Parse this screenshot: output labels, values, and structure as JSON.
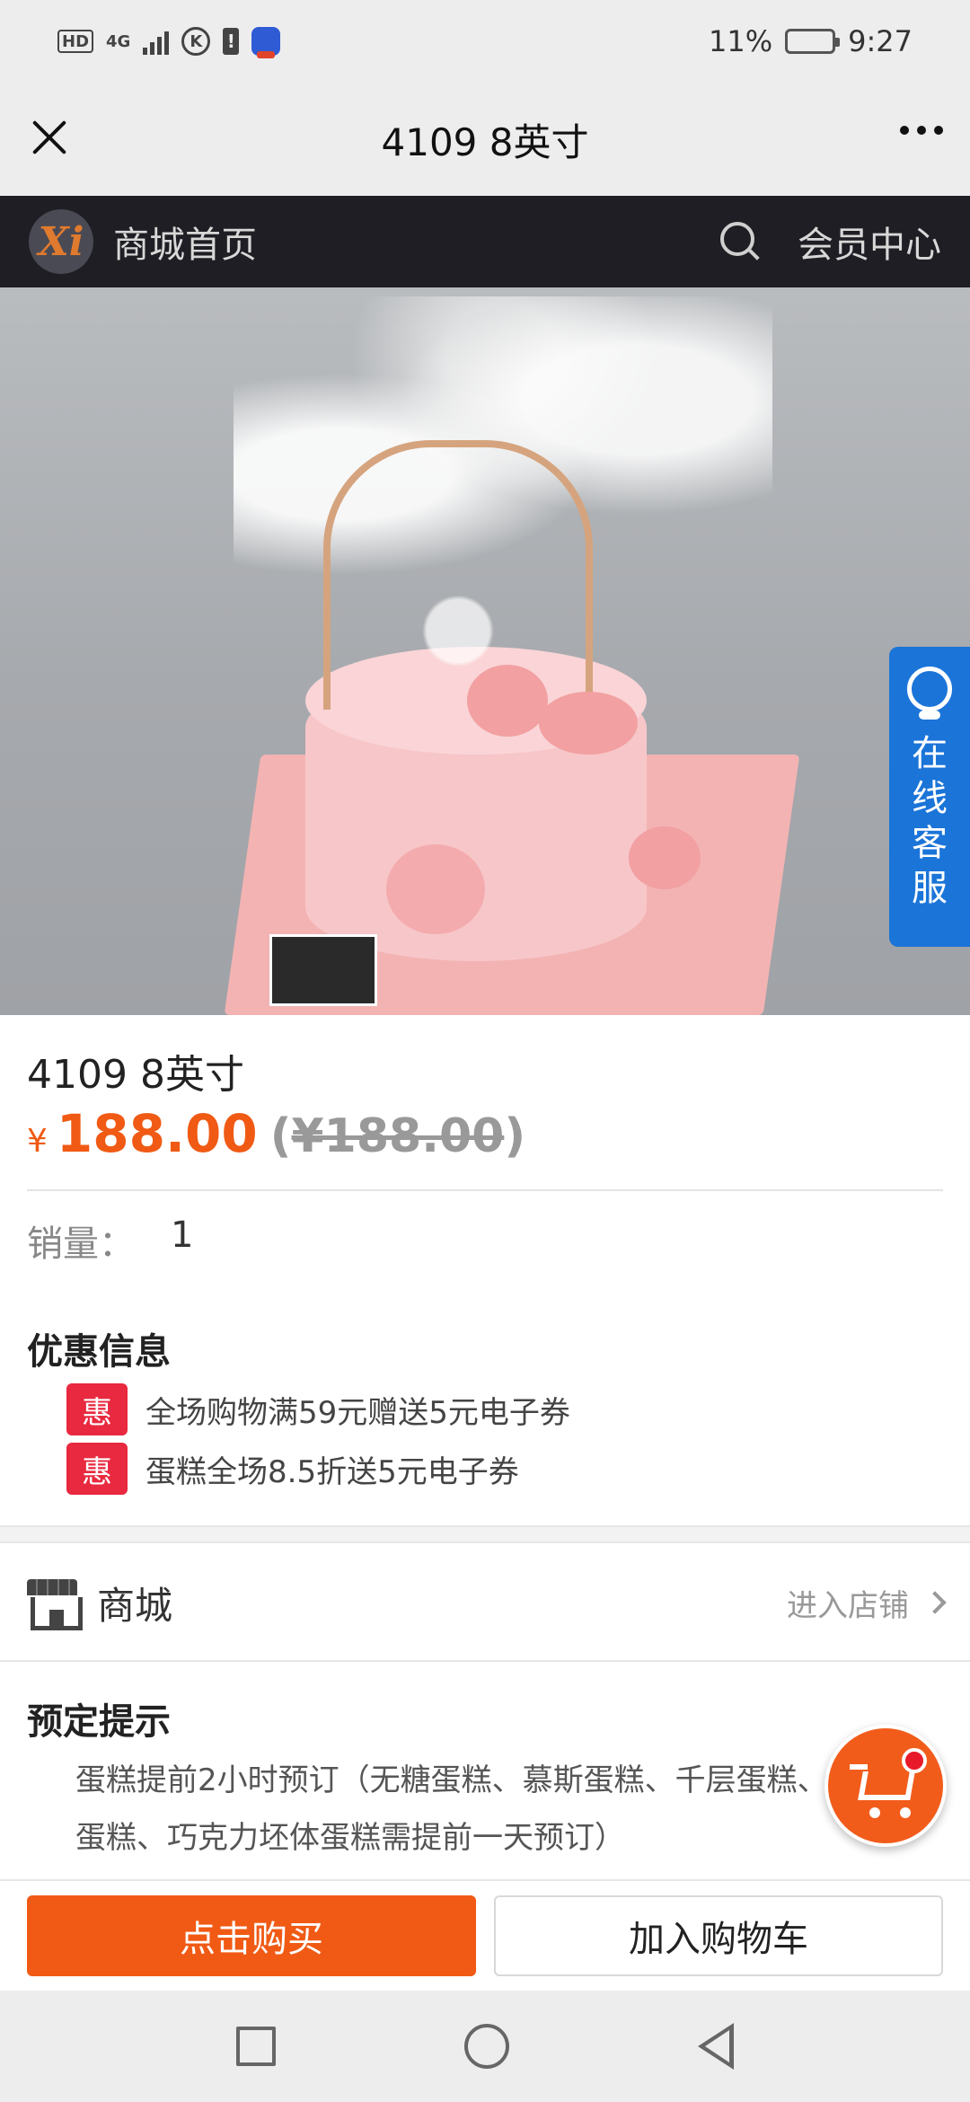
{
  "status_bar": {
    "hd_label": "HD",
    "network_label": "4G",
    "k_label": "K",
    "alert_label": "!",
    "battery_percent": "11%",
    "battery_level": 0.11,
    "time": "9:27"
  },
  "title_bar": {
    "title": "4109 8英寸"
  },
  "store_header": {
    "logo_text": "Xi",
    "home_label": "商城首页",
    "member_center_label": "会员中心"
  },
  "service_tab": {
    "label": "在线客服"
  },
  "product": {
    "name": "4109 8英寸",
    "currency_symbol": "¥",
    "price": "188.00",
    "original_price_open": "(",
    "original_price": "¥188.00",
    "original_price_close": ")",
    "sales_label": "销量：",
    "sales_value": "1"
  },
  "promotions": {
    "title": "优惠信息",
    "items": [
      {
        "badge": "惠",
        "text": "全场购物满59元赠送5元电子券"
      },
      {
        "badge": "惠",
        "text": "蛋糕全场8.5折送5元电子券"
      }
    ]
  },
  "shop": {
    "name": "商城",
    "enter_label": "进入店铺"
  },
  "reservation": {
    "title": "预定提示",
    "text": "蛋糕提前2小时预订（无糖蛋糕、慕斯蛋糕、千层蛋糕、\n蛋糕、巧克力坯体蛋糕需提前一天预订）"
  },
  "actions": {
    "buy_label": "点击购买",
    "add_to_cart_label": "加入购物车"
  },
  "colors": {
    "accent": "#f05a14",
    "promo_badge": "#e8293f",
    "service_tab": "#1b74d8",
    "header_bg": "#1e1e24"
  }
}
